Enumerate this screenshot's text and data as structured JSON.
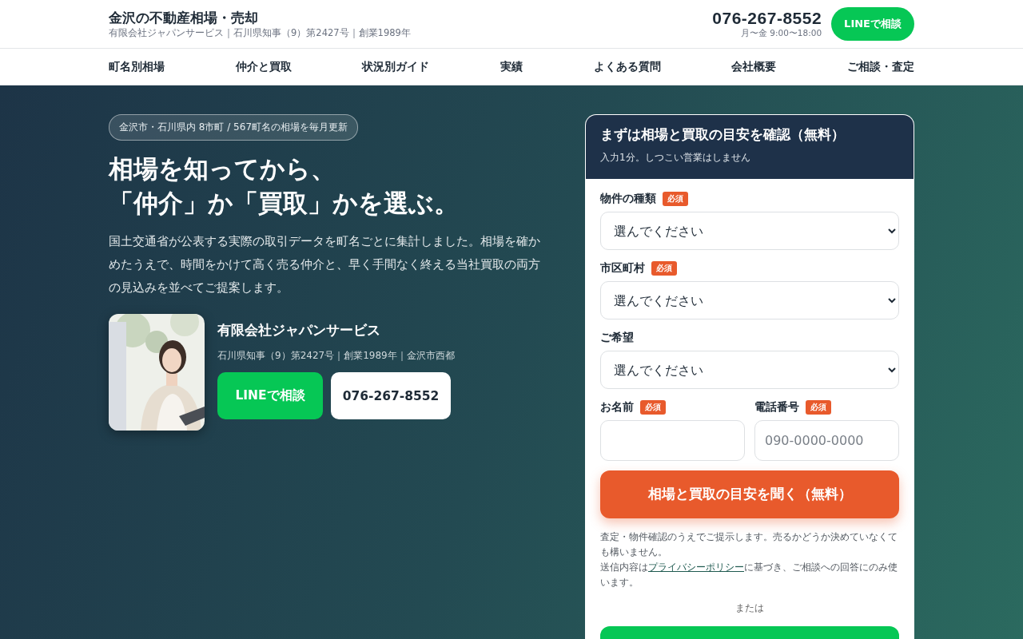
{
  "header": {
    "title": "金沢の不動産相場・売却",
    "subtitle": "有限会社ジャパンサービス｜石川県知事（9）第2427号｜創業1989年",
    "phone": "076-267-8552",
    "hours": "月〜金 9:00〜18:00",
    "line_button": "LINEで相談"
  },
  "nav": [
    "町名別相場",
    "仲介と買取",
    "状況別ガイド",
    "実績",
    "よくある質問",
    "会社概要",
    "ご相談・査定"
  ],
  "hero": {
    "badge": "金沢市・石川県内 8市町 / 567町名の相場を毎月更新",
    "headline": [
      "相場を知ってから、",
      "「仲介」か「買取」かを選ぶ。"
    ],
    "lead": "国土交通省が公表する実際の取引データを町名ごとに集計しました。相場を確かめたうえで、時間をかけて高く売る仲介と、早く手間なく終える当社買取の両方の見込みを並べてご提案します。",
    "company": {
      "name": "有限会社ジャパンサービス",
      "details": "石川県知事（9）第2427号｜創業1989年｜金沢市西都",
      "line_button": "LINEで相談",
      "phone_button": "076-267-8552"
    }
  },
  "form": {
    "title": "まずは相場と買取の目安を確認（無料）",
    "subtitle": "入力1分。しつこい営業はしません",
    "fields": [
      {
        "kind": "select",
        "label": "物件の種類",
        "required_badge": "必須",
        "value": "選んでください"
      },
      {
        "kind": "select",
        "label": "市区町村",
        "required_badge": "必須",
        "value": "選んでください"
      },
      {
        "kind": "select",
        "label": "ご希望",
        "value": "選んでください"
      }
    ],
    "inline_fields": [
      {
        "kind": "text",
        "label": "お名前",
        "required_badge": "必須"
      },
      {
        "kind": "text",
        "label": "電話番号",
        "required_badge": "必須",
        "placeholder": "090-0000-0000"
      }
    ],
    "submit": "相場と買取の目安を聞く（無料）",
    "note": "査定・物件確認のうえでご提示します。売るかどうか決めていなくても構いません。",
    "privacy": {
      "before": "送信内容は",
      "link": "プライバシーポリシー",
      "after": "に基づき、ご相談への回答にのみ使います。"
    },
    "separator": "または"
  }
}
